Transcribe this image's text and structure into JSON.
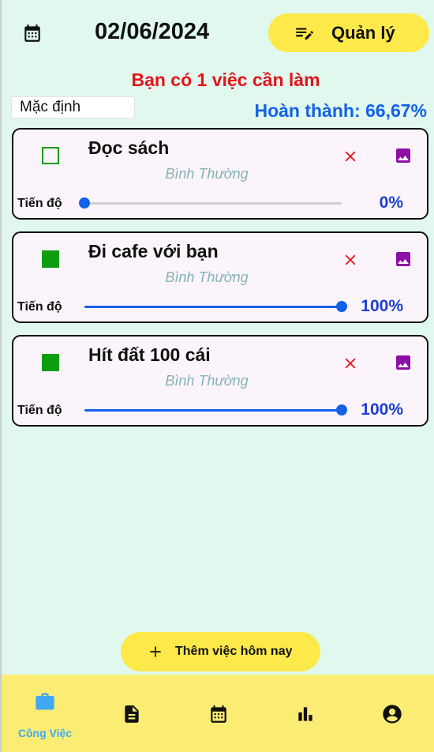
{
  "header": {
    "date": "02/06/2024",
    "manage_label": "Quản lý"
  },
  "summary": {
    "pending_text": "Bạn có 1 việc cần làm",
    "filter_value": "Mặc định",
    "completion_text": "Hoàn thành: 66,67%"
  },
  "tasks": [
    {
      "title": "Đọc sách",
      "priority": "Bình Thường",
      "progress_label": "Tiến độ",
      "progress": 0,
      "progress_text": "0%",
      "done": false
    },
    {
      "title": "Đi cafe với bạn",
      "priority": "Bình Thường",
      "progress_label": "Tiến độ",
      "progress": 100,
      "progress_text": "100%",
      "done": true
    },
    {
      "title": "Hít đất 100 cái",
      "priority": "Bình Thường",
      "progress_label": "Tiến độ",
      "progress": 100,
      "progress_text": "100%",
      "done": true
    }
  ],
  "add_button": {
    "label": "Thêm việc hôm nay"
  },
  "bottom_nav": {
    "active_label": "Công Việc",
    "items": [
      "briefcase-icon",
      "document-icon",
      "calendar-icon",
      "bar-chart-icon",
      "account-icon"
    ]
  },
  "colors": {
    "background": "#e1f8ee",
    "accent_yellow": "#fde94a",
    "pending_red": "#e3141b",
    "completion_blue": "#1261e8",
    "check_green": "#0f9e0f",
    "delete_red": "#e3141b",
    "image_purple": "#8e0fa6",
    "nav_active": "#3fa9f5"
  }
}
